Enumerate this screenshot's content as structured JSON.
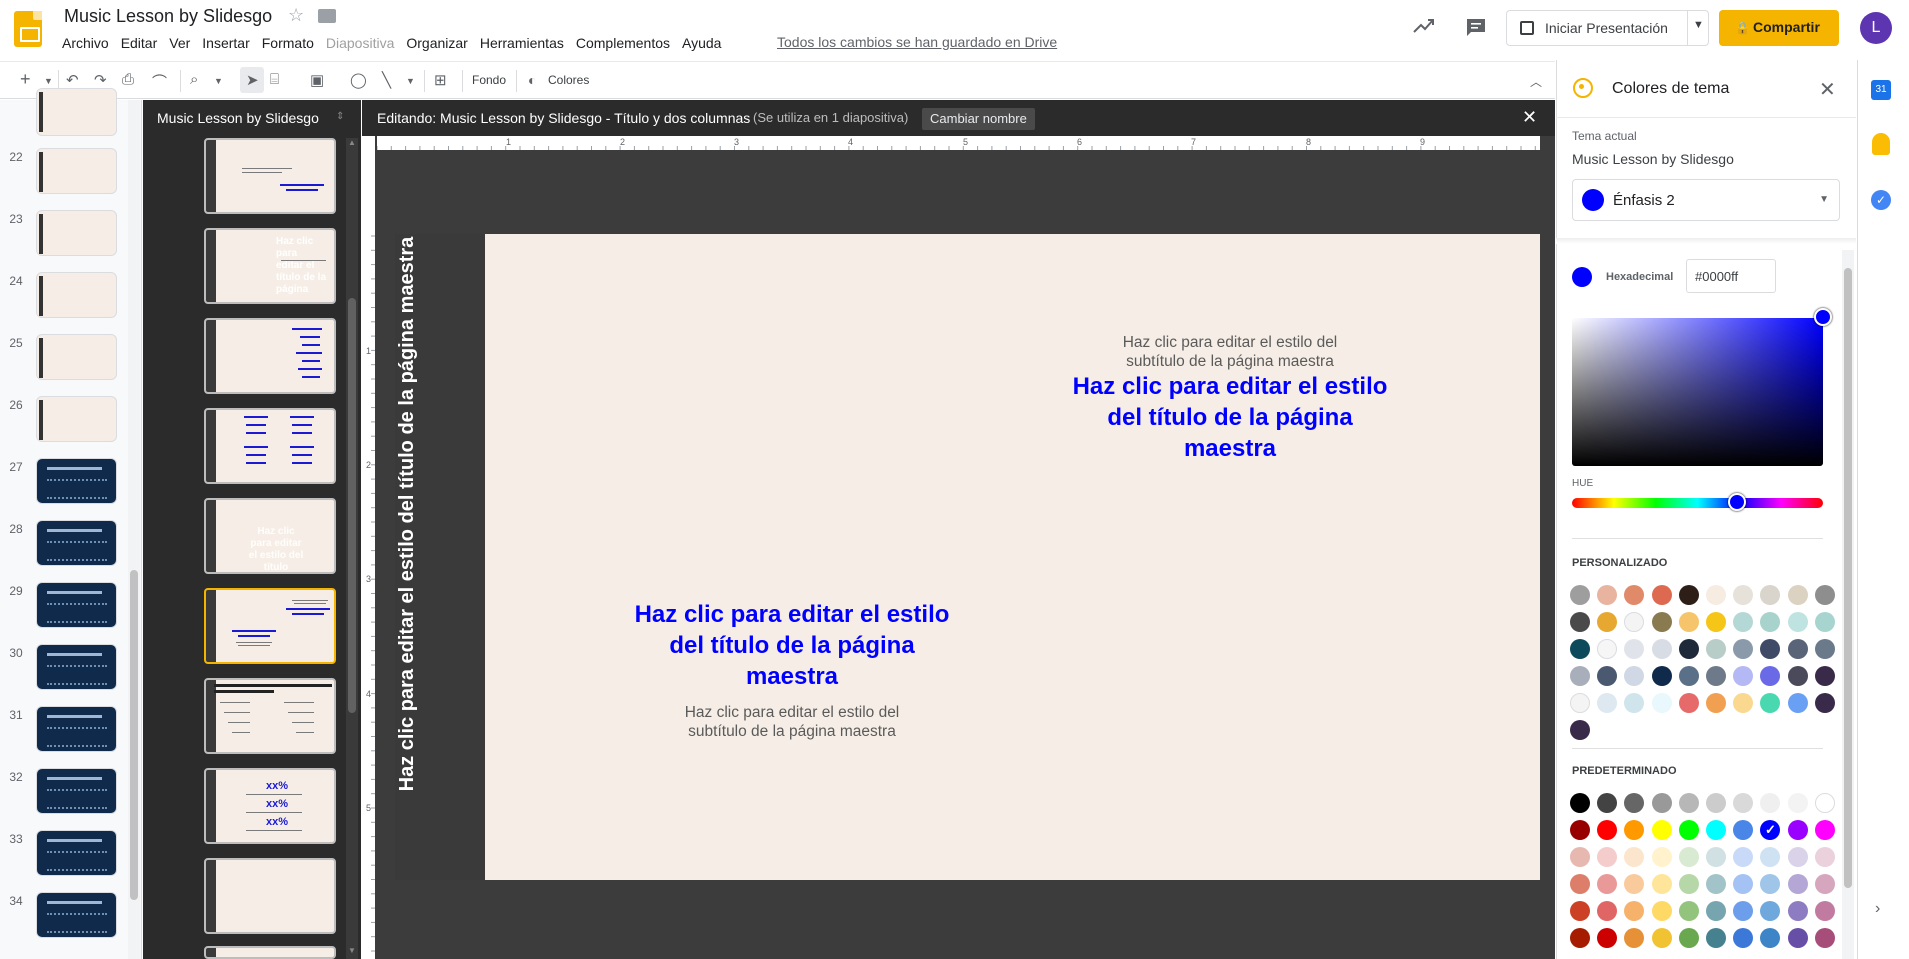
{
  "header": {
    "title": "Music Lesson by Slidesgo",
    "menu": [
      "Archivo",
      "Editar",
      "Ver",
      "Insertar",
      "Formato",
      "Diapositiva",
      "Organizar",
      "Herramientas",
      "Complementos",
      "Ayuda"
    ],
    "saved_status": "Todos los cambios se han guardado en Drive",
    "present_label": "Iniciar Presentación",
    "share_label": "Compartir",
    "avatar_letter": "L"
  },
  "toolbar": {
    "background_label": "Fondo",
    "colors_label": "Colores"
  },
  "filmstrip": {
    "slides": [
      {
        "num": "22",
        "style": "light"
      },
      {
        "num": "23",
        "style": "light"
      },
      {
        "num": "24",
        "style": "light"
      },
      {
        "num": "25",
        "style": "light"
      },
      {
        "num": "26",
        "style": "light"
      },
      {
        "num": "27",
        "style": "dark"
      },
      {
        "num": "28",
        "style": "dark"
      },
      {
        "num": "29",
        "style": "dark"
      },
      {
        "num": "30",
        "style": "dark"
      },
      {
        "num": "31",
        "style": "dark"
      },
      {
        "num": "32",
        "style": "dark"
      },
      {
        "num": "33",
        "style": "dark"
      },
      {
        "num": "34",
        "style": "dark"
      }
    ]
  },
  "layouts": {
    "title": "Music Lesson by Slidesgo",
    "thumb_texts": [
      "xx%",
      "xx%",
      "xx%"
    ]
  },
  "editor": {
    "label": "Editando: Music Lesson by Slidesgo - Título y dos columnas",
    "usage": "(Se utiliza en 1 diapositiva)",
    "rename_label": "Cambiar nombre",
    "ruler_h": [
      "1",
      "2",
      "3",
      "4",
      "5",
      "6",
      "7",
      "8",
      "9"
    ],
    "ruler_v": [
      "1",
      "2",
      "3",
      "4",
      "5"
    ]
  },
  "slide": {
    "vertical_title": "Haz clic para editar el estilo del título de la página maestra",
    "right_subtitle": "Haz clic para editar el estilo del subtítulo de la página maestra",
    "right_title": "Haz clic para editar el estilo del título de la página maestra",
    "left_title": "Haz clic para editar el estilo del título de la página maestra",
    "left_subtitle": "Haz clic para editar el estilo del subtítulo de la página maestra",
    "accent_color": "#0000ff",
    "background_color": "#f6eee6"
  },
  "panel": {
    "title": "Colores de tema",
    "current_label": "Tema actual",
    "current_theme": "Music Lesson by Slidesgo",
    "emphasis_label": "Énfasis 2",
    "hex_label": "Hexadecimal",
    "hex_value": "#0000ff",
    "hue_label": "HUE",
    "custom_label": "PERSONALIZADO",
    "default_label": "PREDETERMINADO",
    "custom_colors": [
      "#9e9e9e",
      "#e8b4a0",
      "#e08a6a",
      "#dd6a50",
      "#2d1f18",
      "#f7ece2",
      "#e6e2da",
      "#d9d4cc",
      "#dcd2c2",
      "#8e8e8e",
      "#4a4a4a",
      "#e6a830",
      "#f4f4f4",
      "#8a7a50",
      "#f6c46a",
      "#f5c518",
      "#b4d8d6",
      "#a8d2cc",
      "#bfe3e0",
      "#a8d4d0",
      "#0d4a5c",
      "#f6f6f6",
      "#e0e4ea",
      "#d8dce4",
      "#1e2a3a",
      "#b8ccc8",
      "#8a9aaa",
      "#3e4a66",
      "#5a6478",
      "#6a7a8a",
      "#a8aeba",
      "#4a5870",
      "#cfd8e4",
      "#0f2a4a",
      "#5a7088",
      "#6e7a8a",
      "#b4b8f4",
      "#6a6ae6",
      "#4a4a5a",
      "#3a2a4a",
      "#f4f4f4",
      "#dde8f0",
      "#d0e4ec",
      "#e8f8fc",
      "#e66a6a",
      "#f0a050",
      "#fad890",
      "#4ad8b0",
      "#6aa0f4",
      "#3a2a4a",
      "#3a2a4a"
    ],
    "default_colors": [
      "#000000",
      "#434343",
      "#666666",
      "#999999",
      "#b7b7b7",
      "#cccccc",
      "#d9d9d9",
      "#efefef",
      "#f3f3f3",
      "#ffffff",
      "#980000",
      "#ff0000",
      "#ff9900",
      "#ffff00",
      "#00ff00",
      "#00ffff",
      "#4a86e8",
      "#0000ff",
      "#9900ff",
      "#ff00ff",
      "#e6b8af",
      "#f4cccc",
      "#fce5cd",
      "#fff2cc",
      "#d9ead3",
      "#d0e0e3",
      "#c9daf8",
      "#cfe2f3",
      "#d9d2e9",
      "#ead1dc",
      "#dd7e6b",
      "#ea9999",
      "#f9cb9c",
      "#ffe599",
      "#b6d7a8",
      "#a2c4c9",
      "#a4c2f4",
      "#9fc5e8",
      "#b4a7d6",
      "#d5a6bd",
      "#cc4125",
      "#e06666",
      "#f6b26b",
      "#ffd966",
      "#93c47d",
      "#76a5af",
      "#6d9eeb",
      "#6fa8dc",
      "#8e7cc3",
      "#c27ba0",
      "#a61c00",
      "#cc0000",
      "#e69138",
      "#f1c232",
      "#6aa84f",
      "#45818e",
      "#3c78d8",
      "#3d85c6",
      "#674ea7",
      "#a64d79"
    ],
    "selected_default_index": 17
  },
  "rail": {
    "calendar_day": "31"
  }
}
